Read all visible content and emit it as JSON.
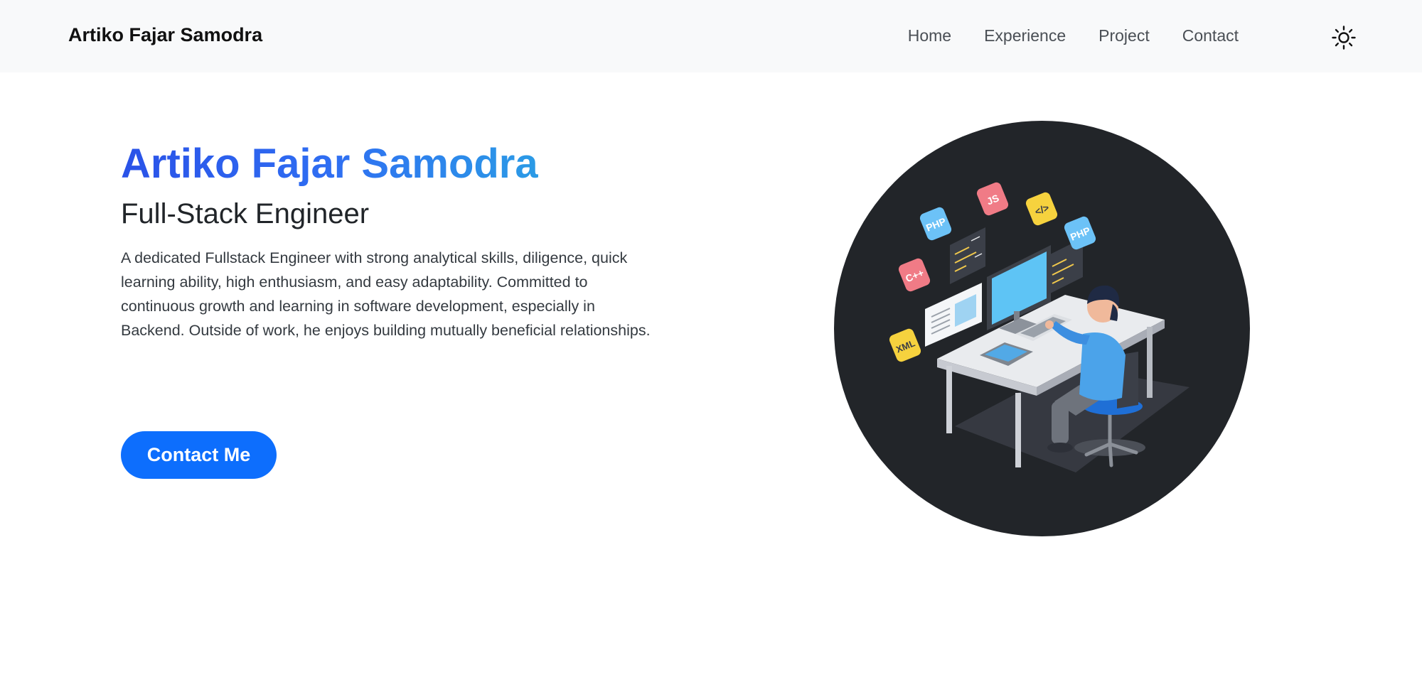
{
  "navbar": {
    "brand": "Artiko Fajar Samodra",
    "links": [
      {
        "label": "Home"
      },
      {
        "label": "Experience"
      },
      {
        "label": "Project"
      },
      {
        "label": "Contact"
      }
    ],
    "theme_icon": "sun-icon"
  },
  "hero": {
    "name": "Artiko Fajar Samodra",
    "role": "Full-Stack Engineer",
    "description": "A dedicated Fullstack Engineer with strong analytical skills, diligence, quick learning ability, high enthusiasm, and easy adaptability. Committed to continuous growth and learning in software development, especially in Backend. Outside of work, he enjoys building mutually beneficial relationships.",
    "cta_label": "Contact Me",
    "badges": [
      "PHP",
      "JS",
      "</>",
      "PHP",
      "C++",
      "XML"
    ]
  },
  "colors": {
    "navbar_bg": "#f8f9fa",
    "accent": "#0d6efd",
    "gradient_start": "#2a52e8",
    "gradient_end": "#2b9be6",
    "illustration_bg": "#222529"
  }
}
